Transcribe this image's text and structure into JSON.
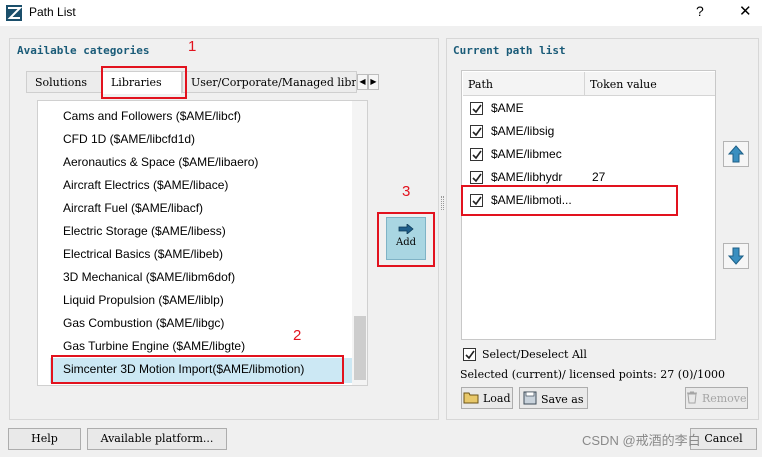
{
  "window": {
    "title": "Path List",
    "help_glyph": "?",
    "close_glyph": "✕",
    "icon": "app-icon"
  },
  "available": {
    "title": "Available categories",
    "tabs": [
      {
        "label": "Solutions"
      },
      {
        "label": "Libraries"
      },
      {
        "label": "User/Corporate/Managed libr"
      }
    ],
    "items": [
      "Cams and Followers ($AME/libcf)",
      "CFD 1D ($AME/libcfd1d)",
      "Aeronautics & Space ($AME/libaero)",
      "Aircraft Electrics ($AME/libace)",
      "Aircraft Fuel ($AME/libacf)",
      "Electric Storage ($AME/libess)",
      "Electrical Basics ($AME/libeb)",
      "3D Mechanical ($AME/libm6dof)",
      "Liquid Propulsion ($AME/liblp)",
      "Gas Combustion ($AME/libgc)",
      "Gas Turbine Engine ($AME/libgte)",
      "Simcenter 3D Motion Import($AME/libmotion)"
    ]
  },
  "add_button": {
    "label": "Add",
    "icon": "arrow-right-icon"
  },
  "current": {
    "title": "Current path list",
    "columns": [
      "Path",
      "Token value"
    ],
    "rows": [
      {
        "path": "$AME",
        "token": "",
        "checked": true
      },
      {
        "path": "$AME/libsig",
        "token": "",
        "checked": true
      },
      {
        "path": "$AME/libmec",
        "token": "",
        "checked": true
      },
      {
        "path": "$AME/libhydr",
        "token": "27",
        "checked": true
      },
      {
        "path": "$AME/libmoti...",
        "token": "",
        "checked": true
      }
    ],
    "select_all_label": "Select/Deselect All",
    "licensed_text": "Selected (current)/ licensed points: 27 (0)/1000",
    "load_label": "Load",
    "save_as_label": "Save as",
    "remove_label": "Remove"
  },
  "footer": {
    "help_label": "Help",
    "platform_label": "Available platform...",
    "cancel_label": "Cancel",
    "watermark": "CSDN @戒酒的李白"
  },
  "annotations": [
    "1",
    "2",
    "3"
  ],
  "colors": {
    "accent_title": "#1a5b78",
    "selection": "#cce8f4",
    "annotation": "#e2121e",
    "add_button": "#a9d6e2"
  }
}
